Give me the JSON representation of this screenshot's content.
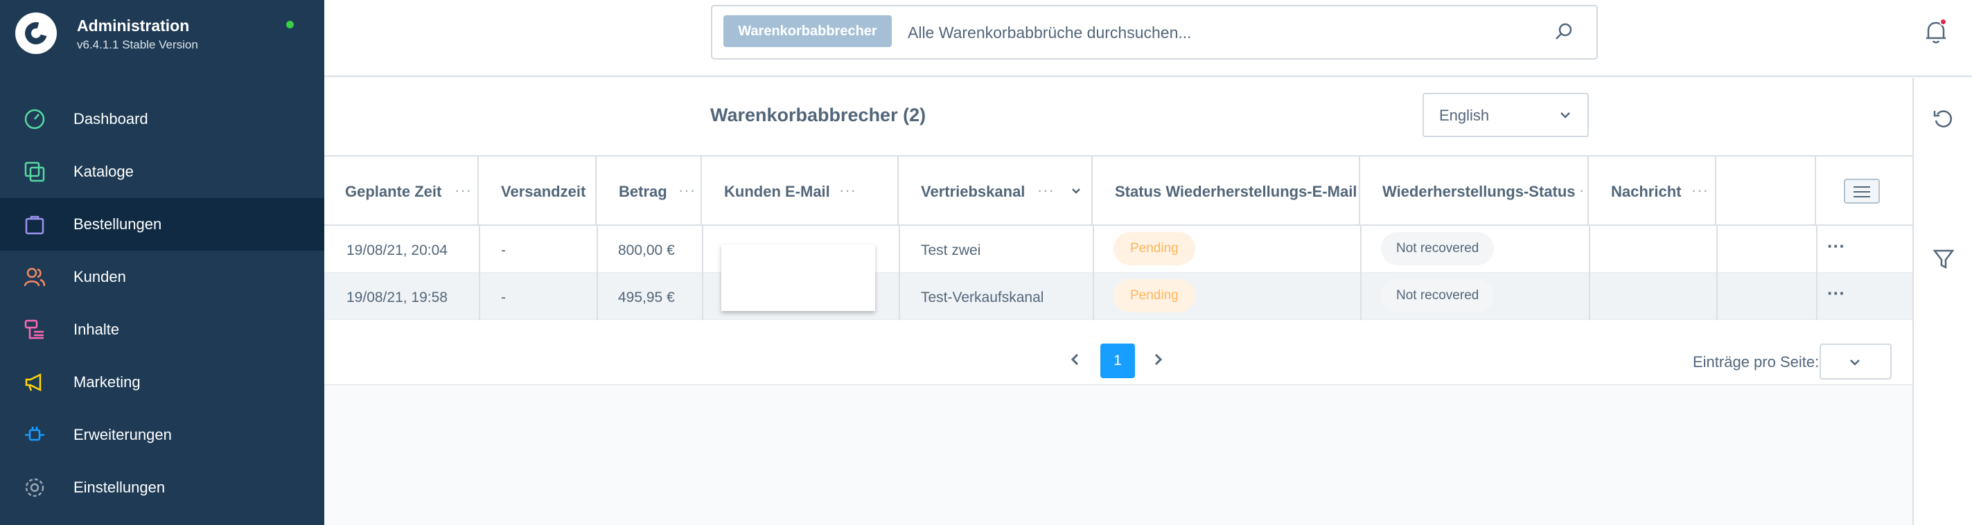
{
  "sidebar": {
    "title": "Administration",
    "version": "v6.4.1.1 Stable Version",
    "items": [
      {
        "label": "Dashboard",
        "icon": "dashboard-icon",
        "color": "#57d9a3"
      },
      {
        "label": "Kataloge",
        "icon": "catalog-icon",
        "color": "#57d9a3"
      },
      {
        "label": "Bestellungen",
        "icon": "orders-icon",
        "color": "#a092f0",
        "active": true
      },
      {
        "label": "Kunden",
        "icon": "customers-icon",
        "color": "#f88962"
      },
      {
        "label": "Inhalte",
        "icon": "content-icon",
        "color": "#ff68b4"
      },
      {
        "label": "Marketing",
        "icon": "marketing-icon",
        "color": "#ffd700"
      },
      {
        "label": "Erweiterungen",
        "icon": "extensions-icon",
        "color": "#189eff"
      },
      {
        "label": "Einstellungen",
        "icon": "settings-icon",
        "color": "#9aa8b5"
      }
    ]
  },
  "search": {
    "tag": "Warenkorbabbrecher",
    "placeholder": "Alle Warenkorbabbrüche durchsuchen..."
  },
  "page": {
    "title": "Warenkorbabbrecher (2)",
    "language": "English"
  },
  "table": {
    "columns": [
      "Geplante Zeit",
      "Versandzeit",
      "Betrag",
      "Kunden E-Mail",
      "Vertriebskanal",
      "Status Wiederherstellungs-E-Mail",
      "Wiederherstellungs-Status",
      "Nachricht"
    ],
    "rows": [
      {
        "scheduled": "19/08/21, 20:04",
        "sent": "-",
        "amount": "800,00 €",
        "email": "",
        "channel": "Test zwei",
        "mail_status": "Pending",
        "recovery_status": "Not recovered",
        "message": ""
      },
      {
        "scheduled": "19/08/21, 19:58",
        "sent": "-",
        "amount": "495,95 €",
        "email": "",
        "channel": "Test-Verkaufskanal",
        "mail_status": "Pending",
        "recovery_status": "Not recovered",
        "message": ""
      }
    ]
  },
  "pagination": {
    "current_page": "1",
    "per_page_label": "Einträge pro Seite:"
  },
  "colors": {
    "sidebar_bg": "#1e3a54",
    "accent": "#189eff",
    "pending": "#ffb75d"
  }
}
